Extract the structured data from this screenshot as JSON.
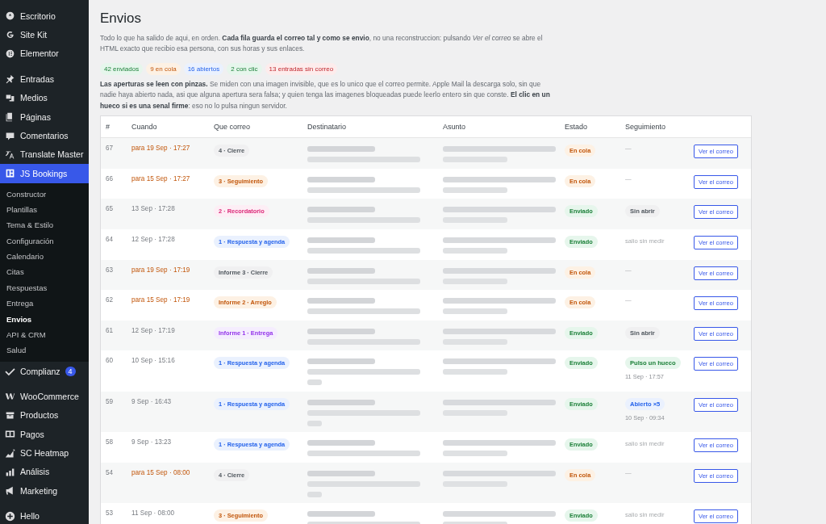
{
  "sidebar": {
    "groups": [
      [
        {
          "label": "Escritorio",
          "selected": false
        },
        {
          "label": "Site Kit",
          "selected": false
        },
        {
          "label": "Elementor",
          "selected": false
        }
      ],
      [
        {
          "label": "Entradas",
          "selected": false
        },
        {
          "label": "Medios",
          "selected": false
        },
        {
          "label": "Páginas",
          "selected": false
        },
        {
          "label": "Comentarios",
          "selected": false
        },
        {
          "label": "Translate Master",
          "selected": false
        },
        {
          "label": "JS Bookings",
          "selected": true,
          "children": [
            {
              "label": "Constructor",
              "selected": false
            },
            {
              "label": "Plantillas",
              "selected": false
            },
            {
              "label": "Tema & Estilo",
              "selected": false
            },
            {
              "label": "Configuración",
              "selected": false
            },
            {
              "label": "Calendario",
              "selected": false
            },
            {
              "label": "Citas",
              "selected": false
            },
            {
              "label": "Respuestas",
              "selected": false
            },
            {
              "label": "Entrega",
              "selected": false
            },
            {
              "label": "Envios",
              "selected": true
            },
            {
              "label": "API & CRM",
              "selected": false
            },
            {
              "label": "Salud",
              "selected": false
            }
          ]
        },
        {
          "label": "Complianz",
          "selected": false,
          "badge": "4"
        }
      ],
      [
        {
          "label": "WooCommerce",
          "selected": false
        },
        {
          "label": "Productos",
          "selected": false
        },
        {
          "label": "Pagos",
          "selected": false
        },
        {
          "label": "SC Heatmap",
          "selected": false
        },
        {
          "label": "Análisis",
          "selected": false
        },
        {
          "label": "Marketing",
          "selected": false
        }
      ],
      [
        {
          "label": "Hello",
          "selected": false
        }
      ]
    ]
  },
  "page": {
    "title": "Envios",
    "intro": "Todo lo que ha salido de aqui, en orden. **Cada fila guarda el correo tal y como se envio**, no una reconstruccion: pulsando *Ver el correo* se abre el HTML exacto que recibio esa persona, con sus horas y sus enlaces.",
    "stats": [
      {
        "label": "42 enviados",
        "kind": "sent"
      },
      {
        "label": "9 en cola",
        "kind": "queued"
      },
      {
        "label": "16 abiertos",
        "kind": "opened"
      },
      {
        "label": "2 con clic",
        "kind": "clicked"
      },
      {
        "label": "13 entradas sin correo",
        "kind": "missing"
      }
    ],
    "note": "**Las aperturas se leen con pinzas.** Se miden con una imagen invisible, que es lo unico que el correo permite. Apple Mail la descarga solo, sin que nadie haya abierto nada, asi que alguna apertura sera falsa; y quien tenga las imagenes bloqueadas puede leerlo entero sin que conste. **El clic en un hueco si es una senal firme**: eso no lo pulsa ningun servidor."
  },
  "table": {
    "columns": [
      "#",
      "Cuando",
      "Que correo",
      "Destinatario",
      "Asunto",
      "Estado",
      "Seguimiento"
    ],
    "rows": [
      {
        "id": "67",
        "tall": false,
        "when": "para 19 Sep · 17:27",
        "mail": {
          "label": "4 · Cierre",
          "kind": "grey"
        },
        "status": {
          "kind": "queued",
          "label": "En cola"
        },
        "follow": {
          "kind": "none",
          "label": "—"
        },
        "action": "Ver el correo"
      },
      {
        "id": "66",
        "tall": false,
        "when": "para 15 Sep · 17:27",
        "mail": {
          "label": "3 · Seguimiento",
          "kind": "orange"
        },
        "status": {
          "kind": "queued",
          "label": "En cola"
        },
        "follow": {
          "kind": "none",
          "label": "—"
        },
        "action": "Ver el correo"
      },
      {
        "id": "65",
        "tall": false,
        "when": "13 Sep · 17:28",
        "mail": {
          "label": "2 · Recordatorio",
          "kind": "pink"
        },
        "status": {
          "kind": "sent",
          "label": "Enviado"
        },
        "follow": {
          "kind": "unopened",
          "label": "Sin abrir"
        },
        "action": "Ver el correo"
      },
      {
        "id": "64",
        "tall": false,
        "when": "12 Sep · 17:28",
        "mail": {
          "label": "1 · Respuesta y agenda",
          "kind": "blue"
        },
        "status": {
          "kind": "sent",
          "label": "Enviado"
        },
        "follow": {
          "kind": "unmeasured",
          "label": "salio sin medir"
        },
        "action": "Ver el correo"
      },
      {
        "id": "63",
        "tall": false,
        "when": "para 19 Sep · 17:19",
        "mail": {
          "label": "Informe 3 · Cierre",
          "kind": "grey"
        },
        "status": {
          "kind": "queued",
          "label": "En cola"
        },
        "follow": {
          "kind": "none",
          "label": "—"
        },
        "action": "Ver el correo"
      },
      {
        "id": "62",
        "tall": false,
        "when": "para 15 Sep · 17:19",
        "mail": {
          "label": "Informe 2 · Arreglo",
          "kind": "orange"
        },
        "status": {
          "kind": "queued",
          "label": "En cola"
        },
        "follow": {
          "kind": "none",
          "label": "—"
        },
        "action": "Ver el correo"
      },
      {
        "id": "61",
        "tall": false,
        "when": "12 Sep · 17:19",
        "mail": {
          "label": "Informe 1 · Entrega",
          "kind": "purple"
        },
        "status": {
          "kind": "sent",
          "label": "Enviado"
        },
        "follow": {
          "kind": "unopened",
          "label": "Sin abrir"
        },
        "action": "Ver el correo"
      },
      {
        "id": "60",
        "when": "10 Sep · 15:16",
        "mail": {
          "label": "1 · Respuesta y agenda",
          "kind": "blue"
        },
        "status": {
          "kind": "sent",
          "label": "Enviado"
        },
        "follow": {
          "kind": "clicked",
          "label": "Pulso un hueco",
          "time": "11 Sep · 17:57"
        },
        "action": "Ver el correo",
        "tall": true
      },
      {
        "id": "59",
        "when": "9 Sep · 16:43",
        "mail": {
          "label": "1 · Respuesta y agenda",
          "kind": "blue"
        },
        "status": {
          "kind": "sent",
          "label": "Enviado"
        },
        "follow": {
          "kind": "opened",
          "label": "Abierto ×5",
          "time": "10 Sep · 09:34"
        },
        "action": "Ver el correo",
        "tall": true
      },
      {
        "id": "58",
        "tall": false,
        "when": "9 Sep · 13:23",
        "mail": {
          "label": "1 · Respuesta y agenda",
          "kind": "blue"
        },
        "status": {
          "kind": "sent",
          "label": "Enviado"
        },
        "follow": {
          "kind": "unmeasured",
          "label": "salio sin medir"
        },
        "action": "Ver el correo"
      },
      {
        "id": "54",
        "when": "para 15 Sep · 08:00",
        "mail": {
          "label": "4 · Cierre",
          "kind": "grey"
        },
        "status": {
          "kind": "queued",
          "label": "En cola"
        },
        "follow": {
          "kind": "none",
          "label": "—"
        },
        "action": "Ver el correo",
        "tall": true
      },
      {
        "id": "53",
        "tall": false,
        "when": "11 Sep · 08:00",
        "mail": {
          "label": "3 · Seguimiento",
          "kind": "orange"
        },
        "status": {
          "kind": "sent",
          "label": "Enviado"
        },
        "follow": {
          "kind": "unmeasured",
          "label": "salio sin medir"
        },
        "action": "Ver el correo"
      }
    ]
  }
}
